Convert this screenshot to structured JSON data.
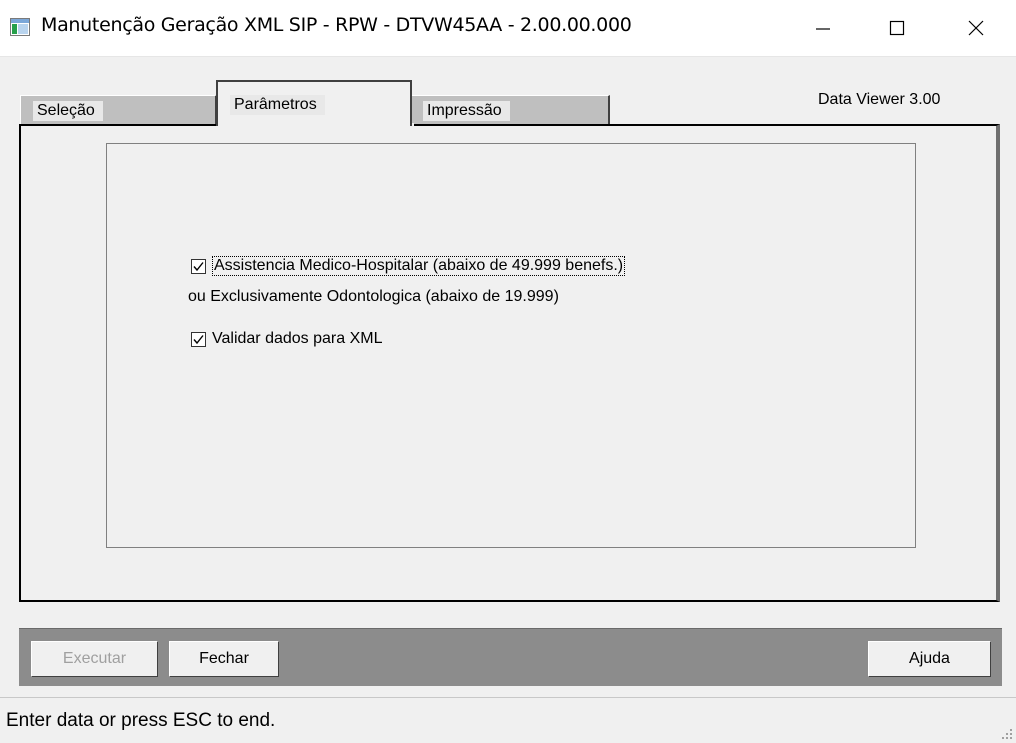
{
  "window": {
    "title": "Manutenção Geração XML SIP - RPW - DTVW45AA - 2.00.00.000"
  },
  "tabs": [
    {
      "label": "Seleção",
      "active": false
    },
    {
      "label": "Parâmetros",
      "active": true
    },
    {
      "label": "Impressão",
      "active": false
    }
  ],
  "data_viewer": "Data Viewer 3.00",
  "params": {
    "checkbox1_label": "Assistencia Medico-Hospitalar  (abaixo de 49.999 benefs.)",
    "checkbox1_checked": true,
    "checkbox1_continuation": "ou Exclusivamente Odontologica (abaixo de 19.999)",
    "checkbox2_label": "Validar dados para XML",
    "checkbox2_checked": true
  },
  "buttons": {
    "execute": "Executar",
    "close": "Fechar",
    "help": "Ajuda"
  },
  "status": {
    "text": "Enter data or press ESC to end."
  },
  "icons": {
    "app": "app-window-icon",
    "minimize": "minimize-icon",
    "maximize": "maximize-icon",
    "close": "close-icon",
    "check": "checkmark-icon",
    "grip": "resize-grip-icon"
  }
}
